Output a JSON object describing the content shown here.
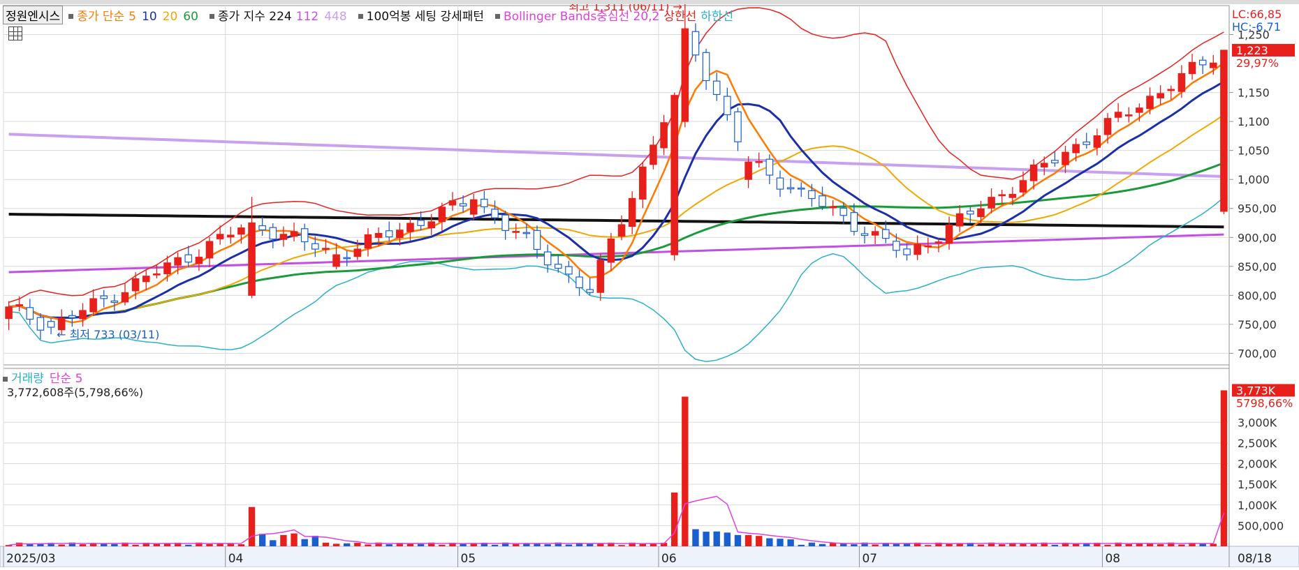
{
  "legend": {
    "stock_name": "정원엔시스",
    "ma_title": "종가 단순",
    "ma_periods": [
      "5",
      "10",
      "20",
      "60"
    ],
    "ma_colors": [
      "#ff7a00",
      "#1a2fa8",
      "#f0a800",
      "#1a9a3a"
    ],
    "long_ma_title": "종가 지수 224",
    "long_ma_periods": [
      "112",
      "448"
    ],
    "long_ma_colors": [
      "#c050e0",
      "#c8a0f0"
    ],
    "pattern": "100억봉 세팅 강세패턴",
    "bb_center": "Bollinger Bands중심선 20,2",
    "bb_upper": "상한선",
    "bb_lower": "하한선"
  },
  "right_info": {
    "lc": "LC:66,85",
    "hc": "HC:-6,71"
  },
  "price_annotations": {
    "high": "최고 1,311 (06/11) →",
    "low": "← 최저 733 (03/11)"
  },
  "current": {
    "price_tag": "1,223",
    "change_pct": "29,97%"
  },
  "volume_legend": {
    "title": "거래량",
    "ma": "단순 5",
    "value": "3,772,608주(5,798,66%)"
  },
  "volume_current": {
    "tag": "3,773K",
    "pct": "5798,66%"
  },
  "x_axis": {
    "labels": [
      "2025/03",
      "04",
      "05",
      "06",
      "07",
      "08"
    ],
    "end_label": "08/18"
  },
  "colors": {
    "up": "#e8201c",
    "down": "#1a5fd0",
    "bb": "#e8201c",
    "bb_lower": "#2ab0c8"
  },
  "chart_data": [
    {
      "type": "candlestick",
      "title": "정원엔시스",
      "y_tick_labels": [
        "700,00",
        "750,00",
        "800,00",
        "850,00",
        "900,00",
        "950,00",
        "1,000",
        "1,050",
        "1,100",
        "1,150",
        "1,250"
      ],
      "y_ticks": [
        700,
        750,
        800,
        850,
        900,
        950,
        1000,
        1050,
        1100,
        1150,
        1250
      ],
      "ylim": [
        680,
        1300
      ],
      "x_tick_dates": [
        "2025/03",
        "04",
        "05",
        "06",
        "07",
        "08"
      ],
      "x_tick_index": [
        0,
        21,
        43,
        62,
        81,
        104
      ],
      "n_bars": 116,
      "key_points": [
        {
          "index": 0,
          "open": 760,
          "close": 780,
          "high": 790,
          "low": 740
        },
        {
          "index": 4,
          "open": 755,
          "close": 745,
          "high": 760,
          "low": 733
        },
        {
          "index": 23,
          "open": 800,
          "close": 925,
          "high": 970,
          "low": 795
        },
        {
          "index": 31,
          "open": 850,
          "close": 870,
          "high": 890,
          "low": 845
        },
        {
          "index": 44,
          "open": 940,
          "close": 965,
          "high": 975,
          "low": 930
        },
        {
          "index": 55,
          "open": 810,
          "close": 805,
          "high": 830,
          "low": 800
        },
        {
          "index": 63,
          "open": 870,
          "close": 1145,
          "high": 1150,
          "low": 860
        },
        {
          "index": 64,
          "open": 1100,
          "close": 1260,
          "high": 1311,
          "low": 1090
        },
        {
          "index": 70,
          "open": 1000,
          "close": 1030,
          "high": 1040,
          "low": 985
        },
        {
          "index": 85,
          "open": 880,
          "close": 870,
          "high": 890,
          "low": 860
        },
        {
          "index": 115,
          "open": 945,
          "close": 1223,
          "high": 1223,
          "low": 940
        }
      ],
      "series": [
        {
          "name": "224",
          "start": 940,
          "end": 918
        },
        {
          "name": "448",
          "start": 1078,
          "end": 1005
        },
        {
          "name": "112",
          "start": 840,
          "end": 905
        }
      ]
    },
    {
      "type": "bar",
      "title": "거래량",
      "y_tick_labels": [
        "500,000",
        "1,000K",
        "1,500K",
        "2,000K",
        "2,500K",
        "3,000K"
      ],
      "y_ticks": [
        500000,
        1000000,
        1500000,
        2000000,
        2500000,
        3000000
      ],
      "ylim": [
        0,
        4000000
      ],
      "key_points": [
        {
          "index": 23,
          "volume": 950000
        },
        {
          "index": 63,
          "volume": 1300000
        },
        {
          "index": 64,
          "volume": 3620000
        },
        {
          "index": 115,
          "volume": 3772608
        }
      ]
    }
  ]
}
